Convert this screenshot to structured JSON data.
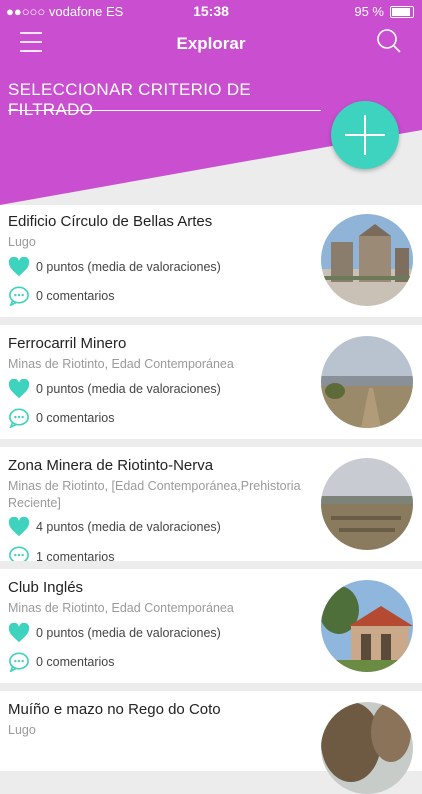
{
  "status_bar": {
    "carrier": "●●○○○ vodafone ES",
    "time": "15:38",
    "battery": "95 %"
  },
  "navbar": {
    "title": "Explorar"
  },
  "filter": {
    "label": "SELECCIONAR CRITERIO DE FILTRADO"
  },
  "colors": {
    "header": "#c94fd0",
    "accent": "#3ed3be"
  },
  "places": [
    {
      "name": "Edificio Círculo de Bellas Artes",
      "location": "Lugo",
      "points": "0 puntos (media de valoraciones)",
      "comments": "0 comentarios"
    },
    {
      "name": "Ferrocarril Minero",
      "location": "Minas de Riotinto, Edad Contemporánea",
      "points": "0 puntos (media de valoraciones)",
      "comments": "0 comentarios"
    },
    {
      "name": "Zona Minera de Riotinto-Nerva",
      "location": "Minas de Riotinto, [Edad Contemporánea,Prehistoria Reciente]",
      "points": "4 puntos (media de valoraciones)",
      "comments": "1 comentarios"
    },
    {
      "name": "Club Inglés",
      "location": "Minas de Riotinto, Edad Contemporánea",
      "points": "0 puntos (media de valoraciones)",
      "comments": "0 comentarios"
    },
    {
      "name": "Muíño e mazo no Rego do Coto",
      "location": "Lugo",
      "points": "",
      "comments": ""
    }
  ]
}
